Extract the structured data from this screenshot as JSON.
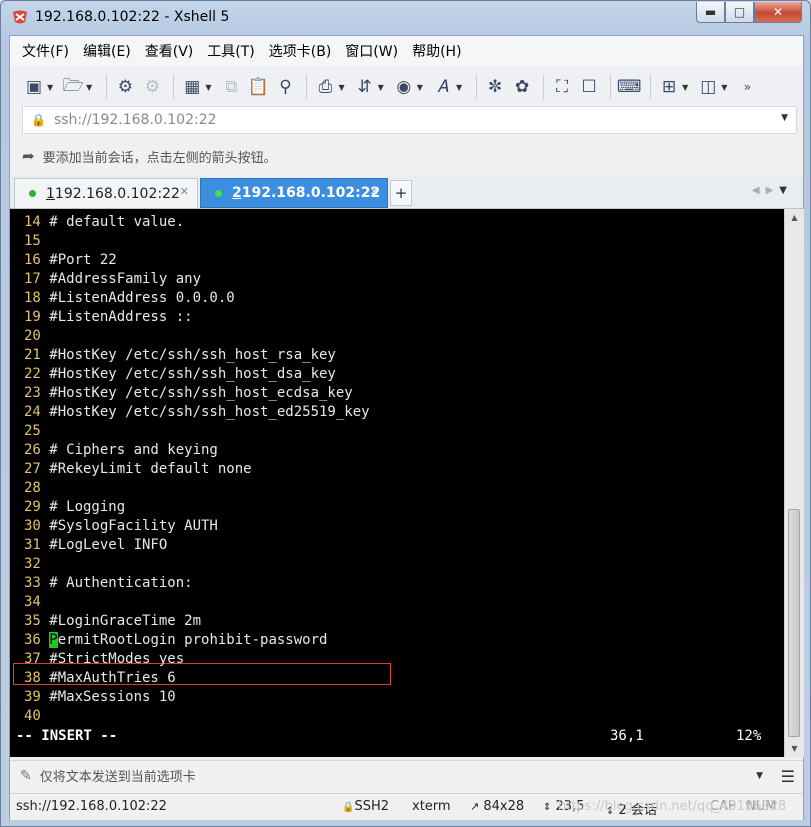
{
  "window": {
    "title": "192.168.0.102:22 - Xshell 5"
  },
  "menu": [
    "文件(F)",
    "编辑(E)",
    "查看(V)",
    "工具(T)",
    "选项卡(B)",
    "窗口(W)",
    "帮助(H)"
  ],
  "address": {
    "value": "ssh://192.168.0.102:22"
  },
  "hint": {
    "text": "要添加当前会话，点击左侧的箭头按钮。"
  },
  "tabs": [
    {
      "num": "1",
      "label": " 192.168.0.102:22",
      "active": false
    },
    {
      "num": "2",
      "label": " 192.168.0.102:22",
      "active": true
    }
  ],
  "terminal": {
    "lines": [
      {
        "n": "14",
        "text": " # default value."
      },
      {
        "n": "15",
        "text": ""
      },
      {
        "n": "16",
        "text": " #Port 22"
      },
      {
        "n": "17",
        "text": " #AddressFamily any"
      },
      {
        "n": "18",
        "text": " #ListenAddress 0.0.0.0"
      },
      {
        "n": "19",
        "text": " #ListenAddress ::"
      },
      {
        "n": "20",
        "text": ""
      },
      {
        "n": "21",
        "text": " #HostKey /etc/ssh/ssh_host_rsa_key"
      },
      {
        "n": "22",
        "text": " #HostKey /etc/ssh/ssh_host_dsa_key"
      },
      {
        "n": "23",
        "text": " #HostKey /etc/ssh/ssh_host_ecdsa_key"
      },
      {
        "n": "24",
        "text": " #HostKey /etc/ssh/ssh_host_ed25519_key"
      },
      {
        "n": "25",
        "text": ""
      },
      {
        "n": "26",
        "text": " # Ciphers and keying"
      },
      {
        "n": "27",
        "text": " #RekeyLimit default none"
      },
      {
        "n": "28",
        "text": ""
      },
      {
        "n": "29",
        "text": " # Logging"
      },
      {
        "n": "30",
        "text": " #SyslogFacility AUTH"
      },
      {
        "n": "31",
        "text": " #LogLevel INFO"
      },
      {
        "n": "32",
        "text": ""
      },
      {
        "n": "33",
        "text": " # Authentication:"
      },
      {
        "n": "34",
        "text": ""
      },
      {
        "n": "35",
        "text": " #LoginGraceTime 2m"
      },
      {
        "n": "36",
        "text": "ermitRootLogin prohibit-password",
        "cursor_char": "P"
      },
      {
        "n": "37",
        "text": " #StrictModes yes"
      },
      {
        "n": "38",
        "text": " #MaxAuthTries 6"
      },
      {
        "n": "39",
        "text": " #MaxSessions 10"
      },
      {
        "n": "40",
        "text": ""
      }
    ],
    "mode": "-- INSERT --",
    "position": "36,1",
    "percent": "12%"
  },
  "send_bar": {
    "placeholder": "仅将文本发送到当前选项卡"
  },
  "status": {
    "host": "ssh://192.168.0.102:22",
    "protocol": "SSH2",
    "term": "xterm",
    "size": "84x28",
    "cursor": "23,5",
    "sessions": "2 会话",
    "cap": "CAP",
    "num": "NUM",
    "watermark": "https://blog.csdn.net/qq_43196028"
  },
  "colors": {
    "terminal_bg": "#000000",
    "line_number": "#e0c36a",
    "active_tab": "#3c8ee0",
    "cursor": "#22c922",
    "highlight": "#e03b3b"
  }
}
